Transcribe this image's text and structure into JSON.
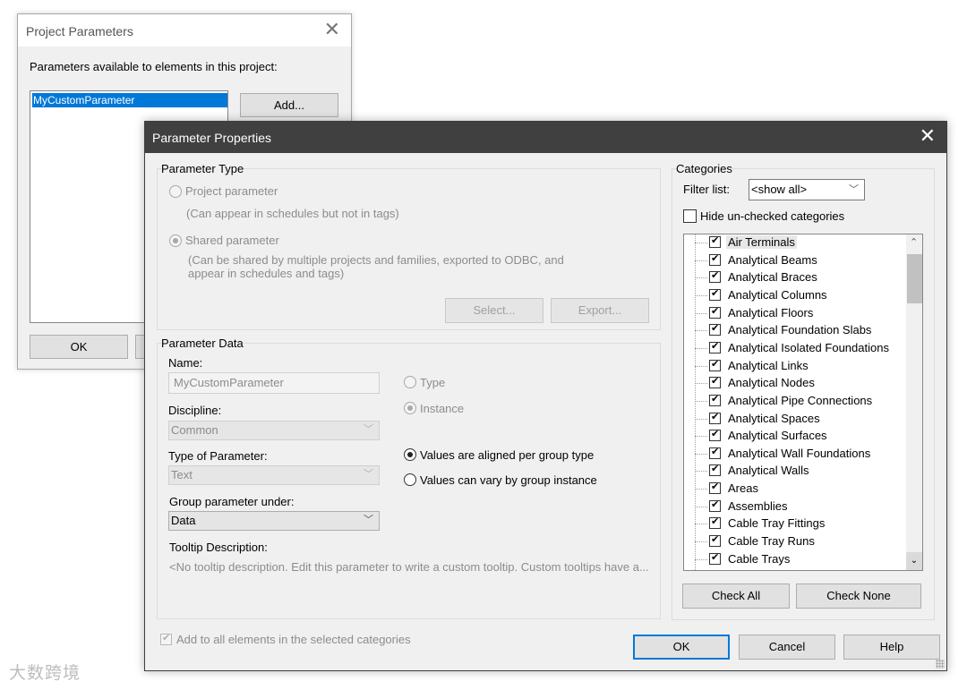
{
  "project_parameters": {
    "title": "Project Parameters",
    "caption": "Parameters available to elements in this project:",
    "selected_item": "MyCustomParameter",
    "add_button": "Add...",
    "ok_button": "OK"
  },
  "parameter_properties": {
    "title": "Parameter Properties",
    "parameter_type": {
      "heading": "Parameter Type",
      "project_option": "Project parameter",
      "project_desc": "(Can appear in schedules but not in tags)",
      "shared_option": "Shared parameter",
      "shared_desc_1": "(Can be shared by multiple projects and families, exported to ODBC, and",
      "shared_desc_2": "appear in schedules and tags)",
      "select_button": "Select...",
      "export_button": "Export..."
    },
    "parameter_data": {
      "heading": "Parameter Data",
      "name_label": "Name:",
      "name_value": "MyCustomParameter",
      "discipline_label": "Discipline:",
      "discipline_value": "Common",
      "type_label": "Type of Parameter:",
      "type_value": "Text",
      "group_label": "Group parameter under:",
      "group_value": "Data",
      "tooltip_label": "Tooltip Description:",
      "tooltip_value": "<No tooltip description. Edit this parameter to write a custom tooltip. Custom tooltips have a...",
      "type_option": "Type",
      "instance_option": "Instance",
      "aligned_option": "Values are aligned per group type",
      "vary_option": "Values can vary by group instance"
    },
    "add_all_checkbox": "Add to all elements in the selected categories",
    "categories": {
      "heading": "Categories",
      "filter_label": "Filter list:",
      "filter_value": "<show all>",
      "hide_unchecked": "Hide un-checked categories",
      "items": [
        "Air Terminals",
        "Analytical Beams",
        "Analytical Braces",
        "Analytical Columns",
        "Analytical Floors",
        "Analytical Foundation Slabs",
        "Analytical Isolated Foundations",
        "Analytical Links",
        "Analytical Nodes",
        "Analytical Pipe Connections",
        "Analytical Spaces",
        "Analytical Surfaces",
        "Analytical Wall Foundations",
        "Analytical Walls",
        "Areas",
        "Assemblies",
        "Cable Tray Fittings",
        "Cable Tray Runs",
        "Cable Trays"
      ],
      "check_all": "Check All",
      "check_none": "Check None"
    },
    "ok_button": "OK",
    "cancel_button": "Cancel",
    "help_button": "Help"
  },
  "watermark": "大数跨境"
}
